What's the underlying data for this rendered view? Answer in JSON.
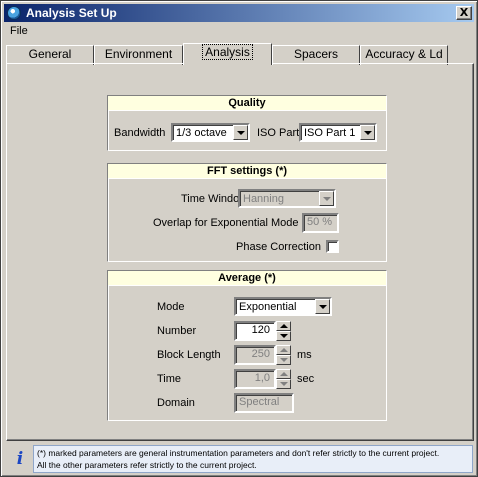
{
  "window": {
    "title": "Analysis Set Up",
    "close_glyph": "X",
    "icon": "app-globe-icon"
  },
  "menubar": {
    "items": [
      "File"
    ]
  },
  "tabs": [
    "General",
    "Environment",
    "Analysis",
    "Spacers",
    "Accuracy & Ld"
  ],
  "active_tab": "Analysis",
  "quality": {
    "title": "Quality",
    "bandwidth_label": "Bandwidth",
    "bandwidth_value": "1/3 octave",
    "iso_part_label": "ISO Part",
    "iso_part_value": "ISO Part 1"
  },
  "fft": {
    "title": "FFT settings (*)",
    "time_window_label": "Time Window",
    "time_window_value": "Hanning",
    "overlap_label": "Overlap for Exponential Mode",
    "overlap_value": "50 %",
    "phase_correction_label": "Phase Correction",
    "phase_correction_checked": false
  },
  "average": {
    "title": "Average (*)",
    "mode_label": "Mode",
    "mode_value": "Exponential",
    "number_label": "Number",
    "number_value": "120",
    "block_length_label": "Block Length",
    "block_length_value": "250",
    "block_length_unit": "ms",
    "time_label": "Time",
    "time_value": "1,0",
    "time_unit": "sec",
    "domain_label": "Domain",
    "domain_value": "Spectral"
  },
  "info": {
    "icon": "info-icon",
    "icon_glyph": "i",
    "line1": "(*) marked parameters are general instrumentation parameters and don't refer strictly to the current project.",
    "line2": "All the other parameters refer strictly to the current project."
  }
}
